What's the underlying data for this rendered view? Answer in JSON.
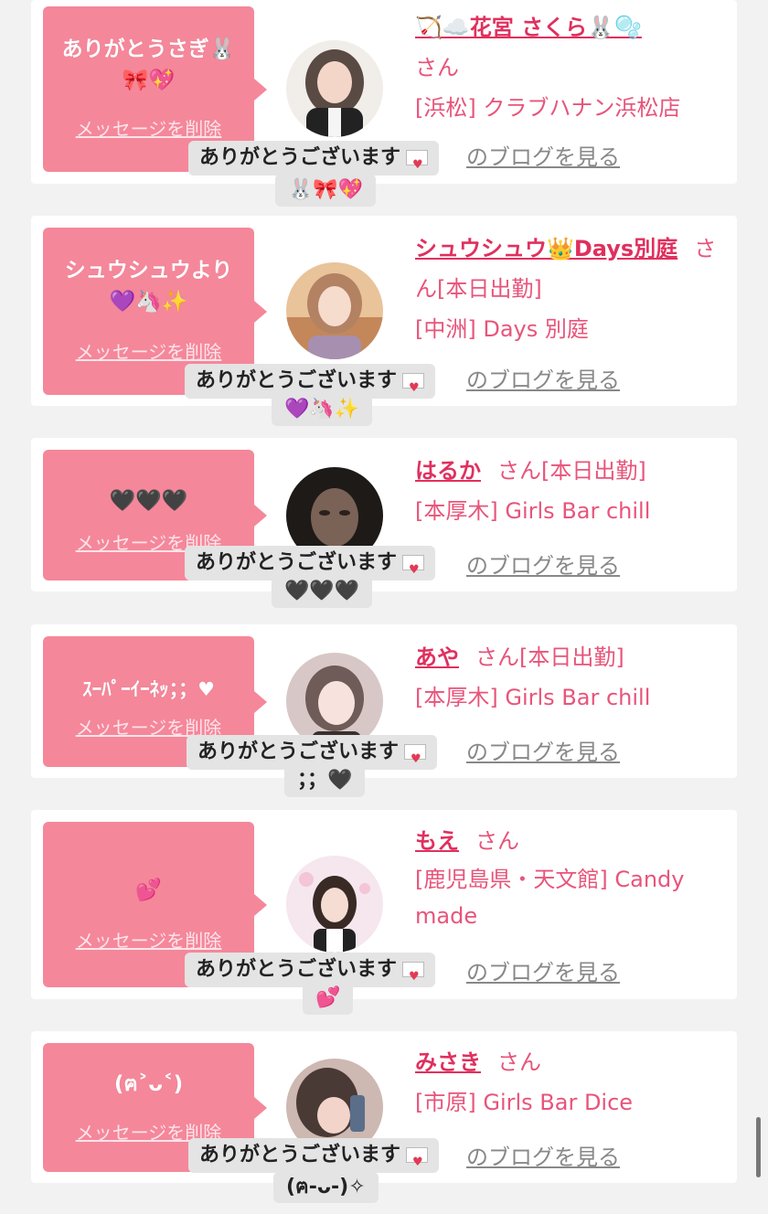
{
  "colors": {
    "bubble": "#f5879a",
    "name": "#e0305e",
    "text": "#e8547a",
    "tooltip": "#e4e4e4"
  },
  "common": {
    "delete_label": "メッセージを削除",
    "thanks_label": "ありがとうございます",
    "blog_label": "のブログを見る",
    "san_label": "さん"
  },
  "cards": [
    {
      "bubble_line1": "ありがとうさぎ🐰",
      "bubble_line2": "🎀💖",
      "name": "🏹☁️花宮 さくら🐰🫧",
      "status": "",
      "shop": "[浜松] クラブハナン浜松店",
      "tip_emoji": "🐰🎀💖"
    },
    {
      "bubble_line1": "シュウシュウより",
      "bubble_line2": "💜🦄✨",
      "name": "シュウシュウ👑Days別庭",
      "status": "[本日出勤]",
      "shop": "[中洲] Days 別庭",
      "tip_emoji": "💜🦄✨"
    },
    {
      "bubble_line1": "🖤🖤🖤",
      "bubble_line2": "",
      "name": "はるか",
      "status": "[本日出勤]",
      "shop": "[本厚木] Girls Bar chill",
      "tip_emoji": "🖤🖤🖤"
    },
    {
      "bubble_line1": "ｽｰﾊﾟｰｲｰﾈｯ；；♥",
      "bubble_line2": "",
      "name": "あや",
      "status": "[本日出勤]",
      "shop": "[本厚木] Girls Bar chill",
      "tip_emoji": "；；🖤"
    },
    {
      "bubble_line1": "💕",
      "bubble_line2": "",
      "name": "もえ",
      "status": "",
      "shop": "[鹿児島県・天文館] Candy made",
      "tip_emoji": "💕"
    },
    {
      "bubble_line1": "(ฅ˃ᴗ˂)",
      "bubble_line2": "",
      "name": "みさき",
      "status": "",
      "shop": "[市原] Girls Bar Dice",
      "tip_emoji": "(ฅ-ᴗ-)✧"
    }
  ]
}
